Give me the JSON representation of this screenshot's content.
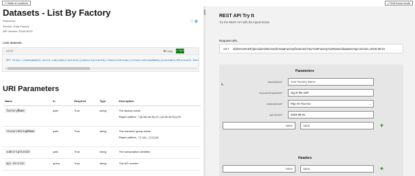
{
  "topbar": {
    "toc_label": "≡ Table of contents",
    "exit_label": "⤢ Exit focus mode"
  },
  "doc": {
    "title": "Datasets - List By Factory",
    "actions_glyph": "♡ ⊕",
    "reference": "Reference",
    "service": "Service: Data Factory",
    "api_version": "API Version: 2018-06-01",
    "lists_label": "Lists datasets.",
    "code_lang": "HTTP",
    "copy_label": "⧉ Copy",
    "tryit_label": "▷ Try It",
    "code_text": "GET https://management.azure.com/subscriptions/{subscriptionId}/resourceGroups/{resourceGroupName}/providers/Microsoft.DataFactory/factories/{factoryName}/datasets?api-version=2018-06-01",
    "uri_title": "URI Parameters",
    "table": {
      "headers": [
        "Name",
        "In",
        "Required",
        "Type",
        "Description"
      ],
      "rows": [
        {
          "name": "factoryName",
          "in": "path",
          "required": "True",
          "type": "string",
          "description": "The factory name.",
          "pattern_label": "Regex pattern:",
          "pattern": "^[A-Za-z0-9]+(?:-[A-Za-z0-9]+)*$"
        },
        {
          "name": "resourceGroupName",
          "in": "path",
          "required": "True",
          "type": "string",
          "description": "The resource group name.",
          "pattern_label": "Regex pattern:",
          "pattern": "^[-\\w\\._\\(\\)]+$"
        },
        {
          "name": "subscriptionId",
          "in": "path",
          "required": "True",
          "type": "string",
          "description": "The subscription identifier.",
          "pattern_label": "",
          "pattern": ""
        },
        {
          "name": "api-version",
          "in": "query",
          "required": "True",
          "type": "string",
          "description": "The API version.",
          "pattern_label": "",
          "pattern": ""
        }
      ]
    }
  },
  "tryit": {
    "title": "REST API Try It",
    "subtitle": "Try the REST API with the inputs below.",
    "request_url_label": "Request URL",
    "method": "GET",
    "url": "s/{the%20ADF}/providers/Microsoft.DataFactory/factories/Your%20Factory%20Name/datasets?api-version=2018-06-01",
    "parameters_heading": "Parameters",
    "params": [
      {
        "label": "factoryName*",
        "value": "Your Factory Name"
      },
      {
        "label": "resourceGroupName*",
        "value": "rsg of the ADF"
      },
      {
        "label": "subscriptionId*",
        "value": "Pay-As-You-Go"
      },
      {
        "label": "api-version*",
        "value": "2018-06-01"
      }
    ],
    "extra_name_placeholder": "name",
    "extra_value_placeholder": "value",
    "headers_heading": "Headers",
    "header_name_placeholder": "name",
    "header_value_placeholder": "value",
    "add_glyph": "+",
    "chevron_glyph": "⌄",
    "cursor_glyph": "↳"
  }
}
